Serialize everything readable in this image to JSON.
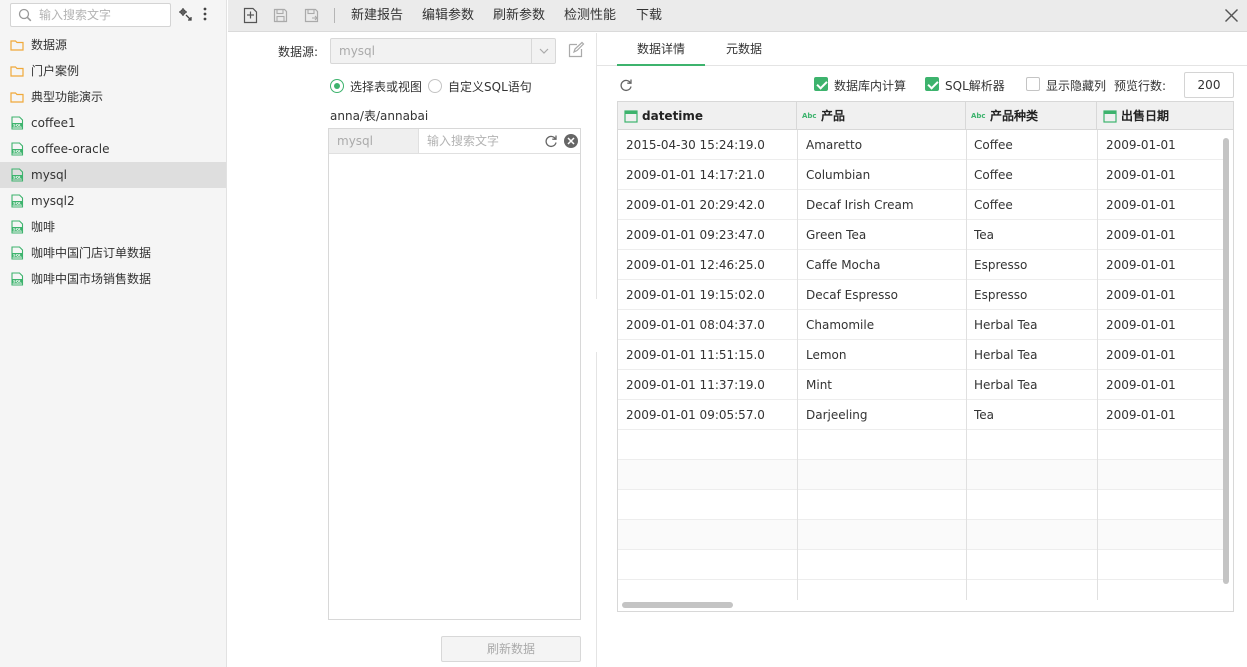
{
  "sidebar": {
    "search_placeholder": "输入搜索文字",
    "items": [
      {
        "label": "数据源",
        "type": "folder"
      },
      {
        "label": "门户案例",
        "type": "folder"
      },
      {
        "label": "典型功能演示",
        "type": "folder"
      },
      {
        "label": "coffee1",
        "type": "sql"
      },
      {
        "label": "coffee-oracle",
        "type": "sql"
      },
      {
        "label": "mysql",
        "type": "sql",
        "selected": true
      },
      {
        "label": "mysql2",
        "type": "sql"
      },
      {
        "label": "咖啡",
        "type": "sql"
      },
      {
        "label": "咖啡中国门店订单数据",
        "type": "sql"
      },
      {
        "label": "咖啡中国市场销售数据",
        "type": "sql"
      }
    ]
  },
  "toolbar": {
    "menu": [
      "新建报告",
      "编辑参数",
      "刷新参数",
      "检测性能",
      "下载"
    ]
  },
  "config": {
    "datasource_label": "数据源:",
    "datasource_value": "mysql",
    "radio_table": "选择表或视图",
    "radio_sql": "自定义SQL语句",
    "path": "anna/表/annabai",
    "db_name": "mysql",
    "table_search_placeholder": "输入搜索文字",
    "refresh_button": "刷新数据"
  },
  "right": {
    "tabs": [
      "数据详情",
      "元数据"
    ],
    "options": {
      "db_compute": "数据库内计算",
      "sql_parser": "SQL解析器",
      "show_hidden": "显示隐藏列",
      "preview_label": "预览行数:",
      "preview_rows": "200"
    },
    "columns": [
      "datetime",
      "产品",
      "产品种类",
      "出售日期"
    ],
    "column_types": [
      "date",
      "text",
      "text",
      "date"
    ],
    "rows": [
      [
        "2015-04-30 15:24:19.0",
        "Amaretto",
        "Coffee",
        "2009-01-01"
      ],
      [
        "2009-01-01 14:17:21.0",
        "Columbian",
        "Coffee",
        "2009-01-01"
      ],
      [
        "2009-01-01 20:29:42.0",
        "Decaf Irish Cream",
        "Coffee",
        "2009-01-01"
      ],
      [
        "2009-01-01 09:23:47.0",
        "Green Tea",
        "Tea",
        "2009-01-01"
      ],
      [
        "2009-01-01 12:46:25.0",
        "Caffe Mocha",
        "Espresso",
        "2009-01-01"
      ],
      [
        "2009-01-01 19:15:02.0",
        "Decaf Espresso",
        "Espresso",
        "2009-01-01"
      ],
      [
        "2009-01-01 08:04:37.0",
        "Chamomile",
        "Herbal Tea",
        "2009-01-01"
      ],
      [
        "2009-01-01 11:51:15.0",
        "Lemon",
        "Herbal Tea",
        "2009-01-01"
      ],
      [
        "2009-01-01 11:37:19.0",
        "Mint",
        "Herbal Tea",
        "2009-01-01"
      ],
      [
        "2009-01-01 09:05:57.0",
        "Darjeeling",
        "Tea",
        "2009-01-01"
      ]
    ]
  },
  "colors": {
    "accent": "#3db36d",
    "folder": "#f0a93a"
  }
}
